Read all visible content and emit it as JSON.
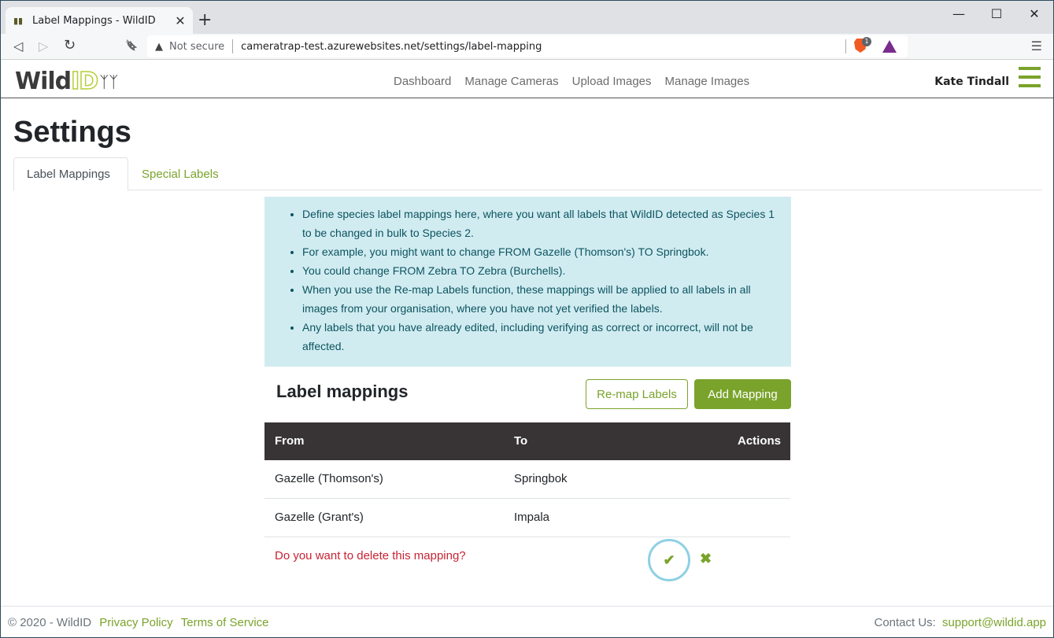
{
  "browser": {
    "tab_title": "Label Mappings - WildID",
    "security_label": "Not secure",
    "url": "cameratrap-test.azurewebsites.net/settings/label-mapping",
    "brave_badge_count": "1",
    "icons": {
      "back": "◁",
      "forward": "▷",
      "reload": "↻",
      "bookmark": "🔖",
      "warning": "▲",
      "menu": "☰",
      "close": "✕",
      "new_tab": "+",
      "minimize": "—",
      "maximize": "☐",
      "win_close": "✕"
    }
  },
  "site": {
    "logo_wild": "Wild",
    "logo_id": "ID",
    "nav": [
      "Dashboard",
      "Manage Cameras",
      "Upload Images",
      "Manage Images"
    ],
    "user_name": "Kate Tindall",
    "accent_color": "#7aa32b"
  },
  "page": {
    "title": "Settings",
    "tabs": [
      {
        "label": "Label Mappings",
        "active": true
      },
      {
        "label": "Special Labels",
        "active": false
      }
    ],
    "info": [
      "Define species label mappings here, where you want all labels that WildID detected as Species 1 to be changed in bulk to Species 2.",
      "For example, you might want to change FROM Gazelle (Thomson's) TO Springbok.",
      "You could change FROM Zebra TO Zebra (Burchells).",
      "When you use the Re-map Labels function, these mappings will be applied to all labels in all images from your organisation, where you have not yet verified the labels.",
      "Any labels that you have already edited, including verifying as correct or incorrect, will not be affected."
    ],
    "section_title": "Label mappings",
    "remap_button": "Re-map Labels",
    "add_button": "Add Mapping",
    "table": {
      "headers": {
        "from": "From",
        "to": "To",
        "actions": "Actions"
      },
      "rows": [
        {
          "from": "Gazelle (Thomson's)",
          "to": "Springbok"
        },
        {
          "from": "Gazelle (Grant's)",
          "to": "Impala"
        }
      ],
      "confirm_text": "Do you want to delete this mapping?",
      "confirm_yes_icon": "✔",
      "confirm_no_icon": "✖"
    }
  },
  "footer": {
    "copyright": "© 2020 - WildID",
    "privacy": "Privacy Policy",
    "terms": "Terms of Service",
    "contact_label": "Contact Us:",
    "contact_email": "support@wildid.app"
  }
}
